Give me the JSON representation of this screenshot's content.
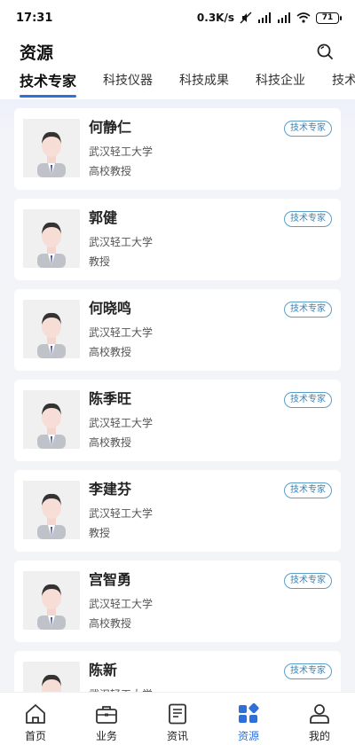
{
  "status_bar": {
    "time": "17:31",
    "speed": "0.3K/s",
    "battery": "71"
  },
  "header": {
    "title": "资源",
    "search_icon": "search-icon"
  },
  "tabs": [
    {
      "label": "技术专家",
      "active": true
    },
    {
      "label": "科技仪器",
      "active": false
    },
    {
      "label": "科技成果",
      "active": false
    },
    {
      "label": "科技企业",
      "active": false
    },
    {
      "label": "技术",
      "active": false
    }
  ],
  "experts": [
    {
      "name": "何静仁",
      "org": "武汉轻工大学",
      "title": "高校教授",
      "badge": "技术专家"
    },
    {
      "name": "郭健",
      "org": "武汉轻工大学",
      "title": "教授",
      "badge": "技术专家"
    },
    {
      "name": "何晓鸣",
      "org": "武汉轻工大学",
      "title": "高校教授",
      "badge": "技术专家"
    },
    {
      "name": "陈季旺",
      "org": "武汉轻工大学",
      "title": "高校教授",
      "badge": "技术专家"
    },
    {
      "name": "李建芬",
      "org": "武汉轻工大学",
      "title": "教授",
      "badge": "技术专家"
    },
    {
      "name": "宫智勇",
      "org": "武汉轻工大学",
      "title": "高校教授",
      "badge": "技术专家"
    },
    {
      "name": "陈新",
      "org": "武汉轻工大学",
      "title": "",
      "badge": "技术专家"
    }
  ],
  "bottom_nav": [
    {
      "label": "首页",
      "icon": "home-icon",
      "active": false
    },
    {
      "label": "业务",
      "icon": "briefcase-icon",
      "active": false
    },
    {
      "label": "资讯",
      "icon": "document-icon",
      "active": false
    },
    {
      "label": "资源",
      "icon": "grid-icon",
      "active": true
    },
    {
      "label": "我的",
      "icon": "user-icon",
      "active": false
    }
  ],
  "colors": {
    "accent": "#2e6fd8",
    "badge_border": "#5a9fc9",
    "list_bg": "#f3f4f8"
  }
}
